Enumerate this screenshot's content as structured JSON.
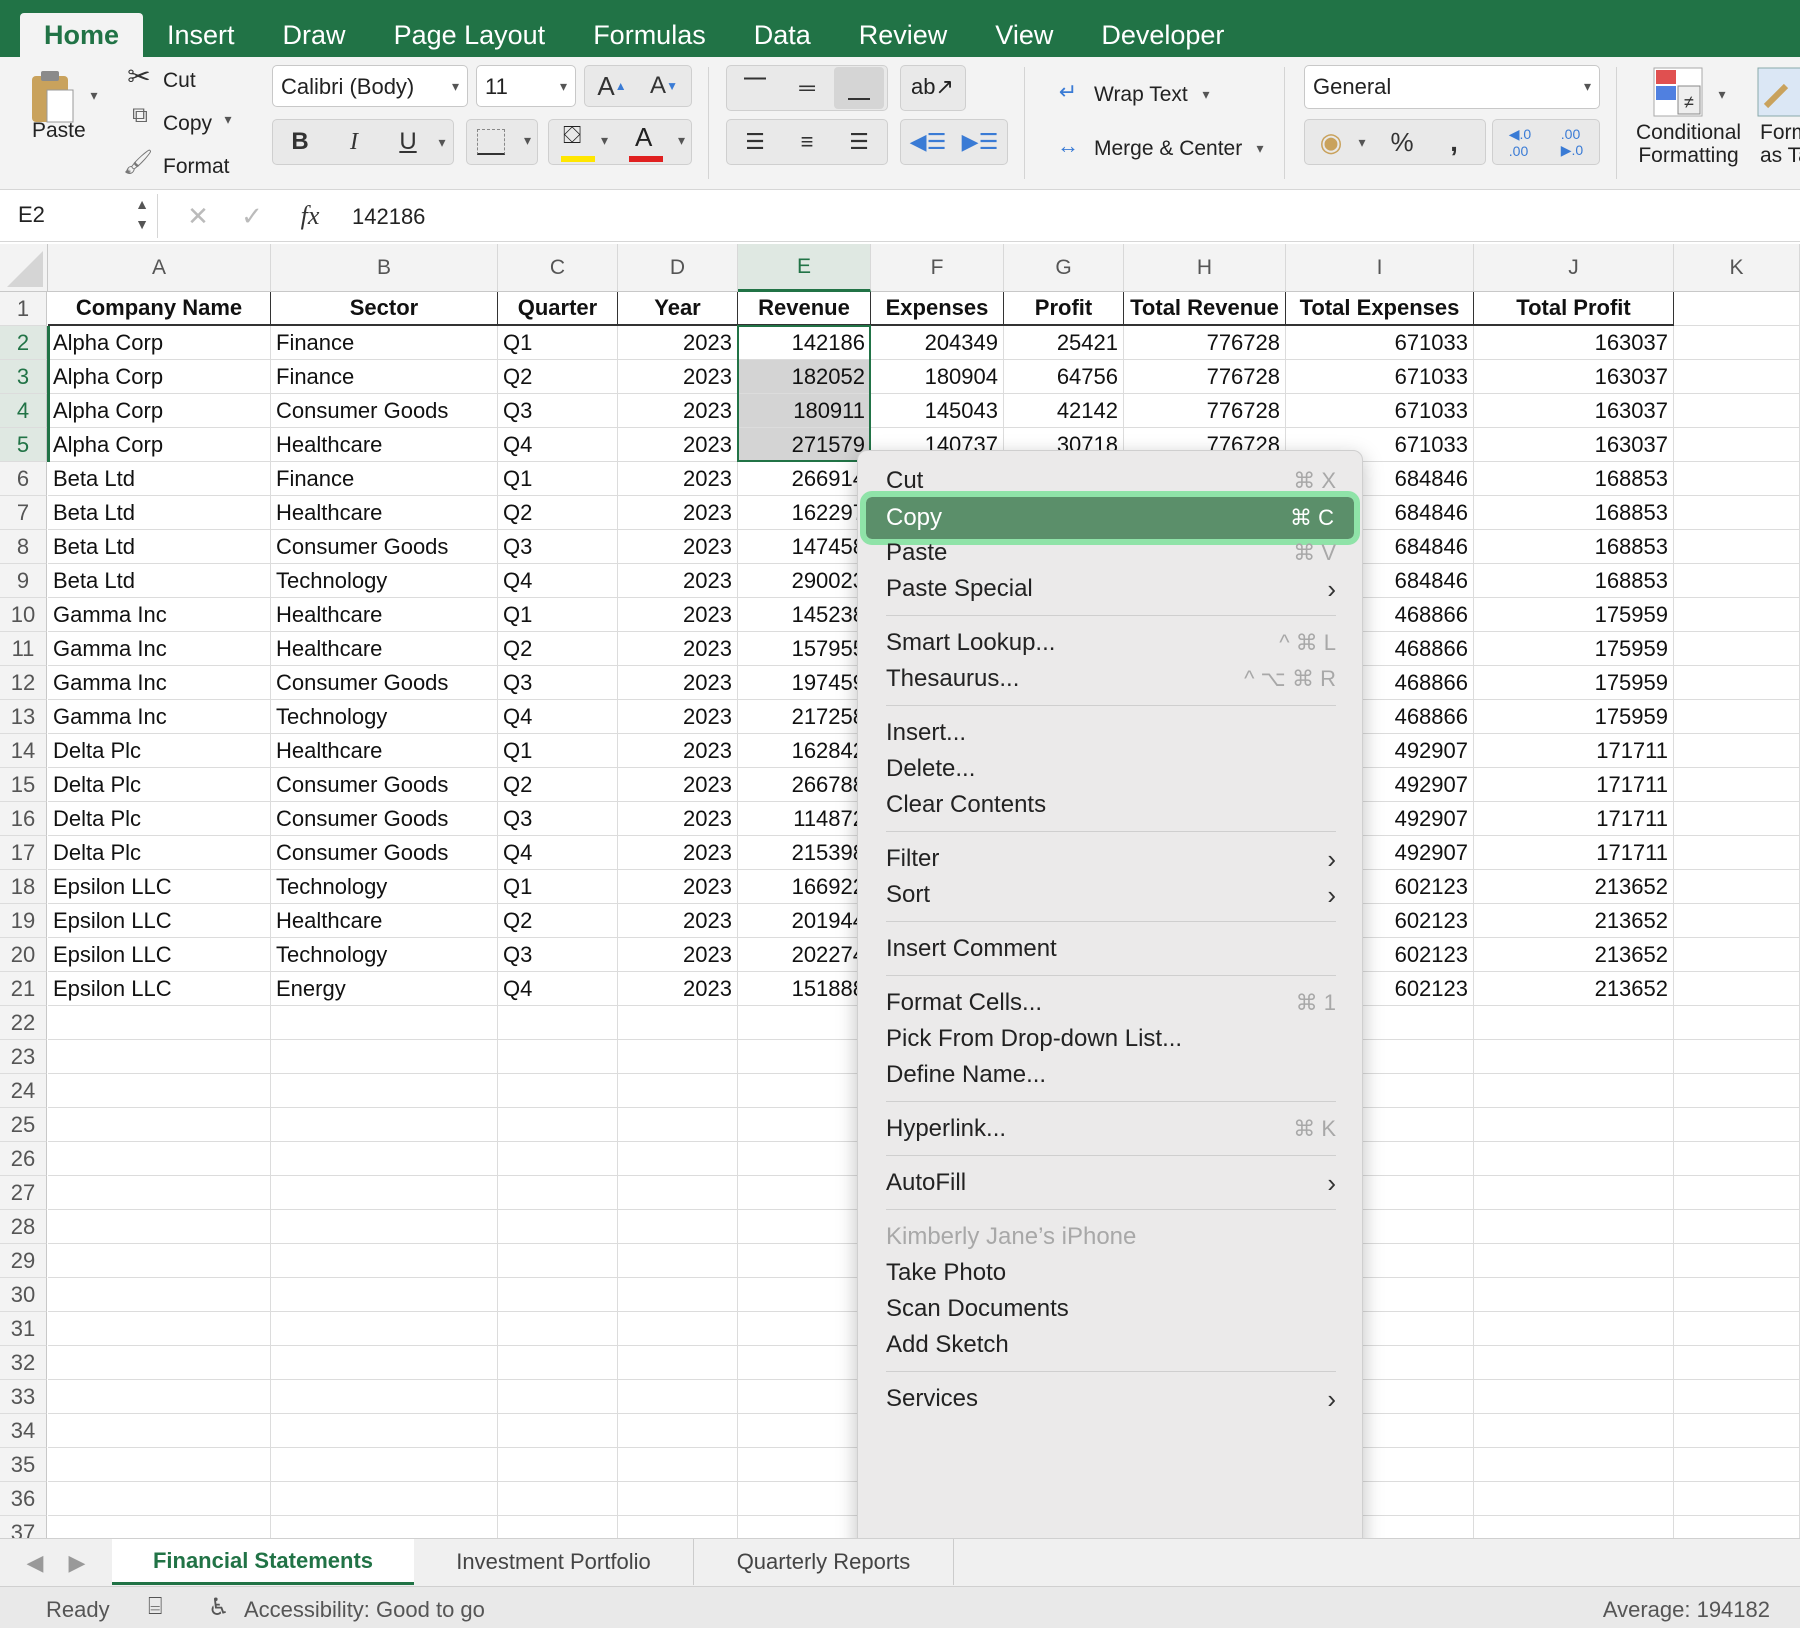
{
  "ribbon_tabs": [
    "Home",
    "Insert",
    "Draw",
    "Page Layout",
    "Formulas",
    "Data",
    "Review",
    "View",
    "Developer"
  ],
  "ribbon": {
    "paste": "Paste",
    "cut": "Cut",
    "copy": "Copy",
    "format": "Format",
    "font_name": "Calibri (Body)",
    "font_size": "11",
    "bold": "B",
    "italic": "I",
    "underline": "U",
    "font_color_letter": "A",
    "wrap_text": "Wrap Text",
    "merge_center": "Merge & Center",
    "number_format": "General",
    "percent": "%",
    "comma": ",",
    "conditional_formatting": "Conditional\nFormatting",
    "format_as_table": "Format\nas Table"
  },
  "formula_bar": {
    "name_box": "E2",
    "fx": "fx",
    "value": "142186"
  },
  "columns": [
    "A",
    "B",
    "C",
    "D",
    "E",
    "F",
    "G",
    "H",
    "I",
    "J",
    "K"
  ],
  "selected_column": "E",
  "headers": [
    "Company Name",
    "Sector",
    "Quarter",
    "Year",
    "Revenue",
    "Expenses",
    "Profit",
    "Total Revenue",
    "Total Expenses",
    "Total Profit"
  ],
  "rows": [
    [
      "Alpha Corp",
      "Finance",
      "Q1",
      "2023",
      "142186",
      "204349",
      "25421",
      "776728",
      "671033",
      "163037"
    ],
    [
      "Alpha Corp",
      "Finance",
      "Q2",
      "2023",
      "182052",
      "180904",
      "64756",
      "776728",
      "671033",
      "163037"
    ],
    [
      "Alpha Corp",
      "Consumer Goods",
      "Q3",
      "2023",
      "180911",
      "145043",
      "42142",
      "776728",
      "671033",
      "163037"
    ],
    [
      "Alpha Corp",
      "Healthcare",
      "Q4",
      "2023",
      "271579",
      "140737",
      "30718",
      "776728",
      "671033",
      "163037"
    ],
    [
      "Beta Ltd",
      "Finance",
      "Q1",
      "2023",
      "266914",
      "",
      "",
      "",
      "684846",
      "168853"
    ],
    [
      "Beta Ltd",
      "Healthcare",
      "Q2",
      "2023",
      "162297",
      "",
      "",
      "",
      "684846",
      "168853"
    ],
    [
      "Beta Ltd",
      "Consumer Goods",
      "Q3",
      "2023",
      "147458",
      "",
      "",
      "",
      "684846",
      "168853"
    ],
    [
      "Beta Ltd",
      "Technology",
      "Q4",
      "2023",
      "290023",
      "",
      "",
      "",
      "684846",
      "168853"
    ],
    [
      "Gamma Inc",
      "Healthcare",
      "Q1",
      "2023",
      "145238",
      "",
      "",
      "",
      "468866",
      "175959"
    ],
    [
      "Gamma Inc",
      "Healthcare",
      "Q2",
      "2023",
      "157955",
      "",
      "",
      "",
      "468866",
      "175959"
    ],
    [
      "Gamma Inc",
      "Consumer Goods",
      "Q3",
      "2023",
      "197459",
      "",
      "",
      "",
      "468866",
      "175959"
    ],
    [
      "Gamma Inc",
      "Technology",
      "Q4",
      "2023",
      "217258",
      "",
      "",
      "",
      "468866",
      "175959"
    ],
    [
      "Delta Plc",
      "Healthcare",
      "Q1",
      "2023",
      "162842",
      "",
      "",
      "",
      "492907",
      "171711"
    ],
    [
      "Delta Plc",
      "Consumer Goods",
      "Q2",
      "2023",
      "266788",
      "",
      "",
      "",
      "492907",
      "171711"
    ],
    [
      "Delta Plc",
      "Consumer Goods",
      "Q3",
      "2023",
      "114872",
      "",
      "",
      "",
      "492907",
      "171711"
    ],
    [
      "Delta Plc",
      "Consumer Goods",
      "Q4",
      "2023",
      "215398",
      "",
      "",
      "",
      "492907",
      "171711"
    ],
    [
      "Epsilon LLC",
      "Technology",
      "Q1",
      "2023",
      "166922",
      "",
      "",
      "",
      "602123",
      "213652"
    ],
    [
      "Epsilon LLC",
      "Healthcare",
      "Q2",
      "2023",
      "201944",
      "",
      "",
      "",
      "602123",
      "213652"
    ],
    [
      "Epsilon LLC",
      "Technology",
      "Q3",
      "2023",
      "202274",
      "",
      "",
      "",
      "602123",
      "213652"
    ],
    [
      "Epsilon LLC",
      "Energy",
      "Q4",
      "2023",
      "151888",
      "",
      "",
      "",
      "602123",
      "213652"
    ]
  ],
  "row_count": 37,
  "context_menu": [
    {
      "label": "Cut",
      "shortcut": "⌘ X"
    },
    {
      "label": "Copy",
      "shortcut": "⌘ C",
      "highlighted": true
    },
    {
      "label": "Paste",
      "shortcut": "⌘ V"
    },
    {
      "label": "Paste Special",
      "submenu": true
    },
    {
      "sep": true
    },
    {
      "label": "Smart Lookup...",
      "shortcut": "^ ⌘ L"
    },
    {
      "label": "Thesaurus...",
      "shortcut": "^ ⌥ ⌘ R"
    },
    {
      "sep": true
    },
    {
      "label": "Insert..."
    },
    {
      "label": "Delete..."
    },
    {
      "label": "Clear Contents"
    },
    {
      "sep": true
    },
    {
      "label": "Filter",
      "submenu": true
    },
    {
      "label": "Sort",
      "submenu": true
    },
    {
      "sep": true
    },
    {
      "label": "Insert Comment"
    },
    {
      "sep": true
    },
    {
      "label": "Format Cells...",
      "shortcut": "⌘ 1"
    },
    {
      "label": "Pick From Drop-down List..."
    },
    {
      "label": "Define Name..."
    },
    {
      "sep": true
    },
    {
      "label": "Hyperlink...",
      "shortcut": "⌘ K"
    },
    {
      "sep": true
    },
    {
      "label": "AutoFill",
      "submenu": true
    },
    {
      "sep": true
    },
    {
      "label": "Kimberly Jane’s iPhone",
      "disabled": true
    },
    {
      "label": "Take Photo"
    },
    {
      "label": "Scan Documents"
    },
    {
      "label": "Add Sketch"
    },
    {
      "sep": true
    },
    {
      "label": "Services",
      "submenu": true
    }
  ],
  "sheet_tabs": [
    "Financial Statements",
    "Investment Portfolio",
    "Quarterly Reports"
  ],
  "active_sheet": "Financial Statements",
  "status": {
    "ready": "Ready",
    "accessibility": "Accessibility: Good to go",
    "average": "Average: 194182"
  },
  "colors": {
    "excel_green": "#217346",
    "highlight_green": "#8fe3a8",
    "menu_selected": "#5b8f6a"
  }
}
